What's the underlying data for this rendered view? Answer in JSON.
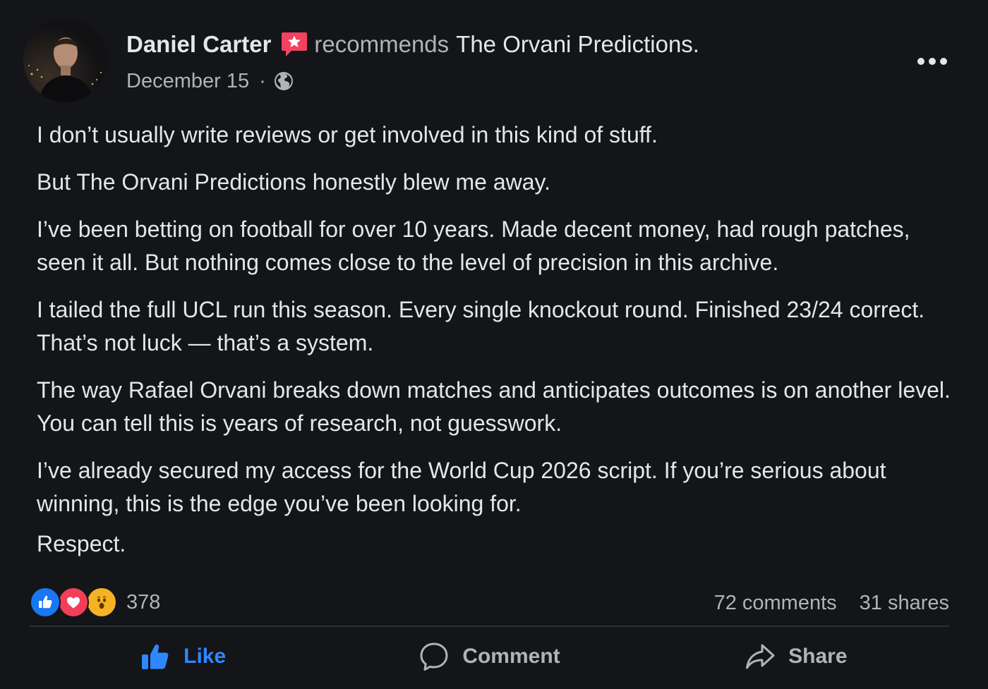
{
  "post": {
    "author": "Daniel Carter",
    "recommends_word": "recommends",
    "page_name": "The Orvani Predictions.",
    "date": "December 15",
    "separator": "·",
    "audience_icon": "globe-icon",
    "more_icon": "more-options-icon"
  },
  "body": {
    "paragraphs": [
      "I don’t usually write reviews or get involved in this kind of stuff.",
      "But The Orvani Predictions honestly blew me away.",
      "I’ve been betting on football for over 10 years. Made decent money, had rough patches, seen it all. But nothing comes close to the level of precision in this archive.",
      "I tailed the full UCL run this season. Every single knockout round. Finished 23/24 correct. That’s not luck — that’s a system.",
      "The way Rafael Orvani breaks down matches and anticipates outcomes is on another level. You can tell this is years of research, not guesswork.",
      "I’ve already secured my access for the World Cup 2026 script. If you’re serious about winning, this is the edge you’ve been looking for.",
      "Respect."
    ]
  },
  "stats": {
    "reaction_count": "378",
    "reaction_icons": [
      "like-icon",
      "love-icon",
      "wow-icon"
    ],
    "comments": "72 comments",
    "shares": "31 shares"
  },
  "actions": {
    "like_label": "Like",
    "comment_label": "Comment",
    "share_label": "Share"
  },
  "colors": {
    "background": "#141518",
    "text_primary": "#e4e6eb",
    "text_secondary": "#b0b3b8",
    "like_blue": "#2d88ff",
    "recommend_red": "#f3425f"
  }
}
